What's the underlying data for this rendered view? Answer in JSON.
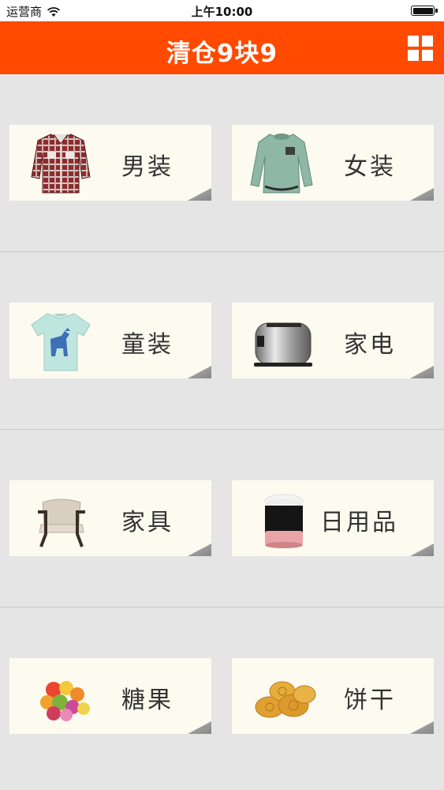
{
  "status_bar": {
    "carrier": "运营商",
    "time": "上午10:00"
  },
  "nav": {
    "title": "清仓9块9",
    "menu_icon": "grid-menu-icon"
  },
  "categories": [
    {
      "label": "男装",
      "icon": "men-shirt-image"
    },
    {
      "label": "女装",
      "icon": "women-sweater-image"
    },
    {
      "label": "童装",
      "icon": "kids-tshirt-image"
    },
    {
      "label": "家电",
      "icon": "toaster-image"
    },
    {
      "label": "家具",
      "icon": "armchair-image"
    },
    {
      "label": "日用品",
      "icon": "cosmetic-jar-image"
    },
    {
      "label": "糖果",
      "icon": "candy-image"
    },
    {
      "label": "饼干",
      "icon": "biscuit-image"
    }
  ],
  "colors": {
    "accent": "#ff4a00",
    "background": "#e5e5e5",
    "card": "#fdfbf0"
  }
}
